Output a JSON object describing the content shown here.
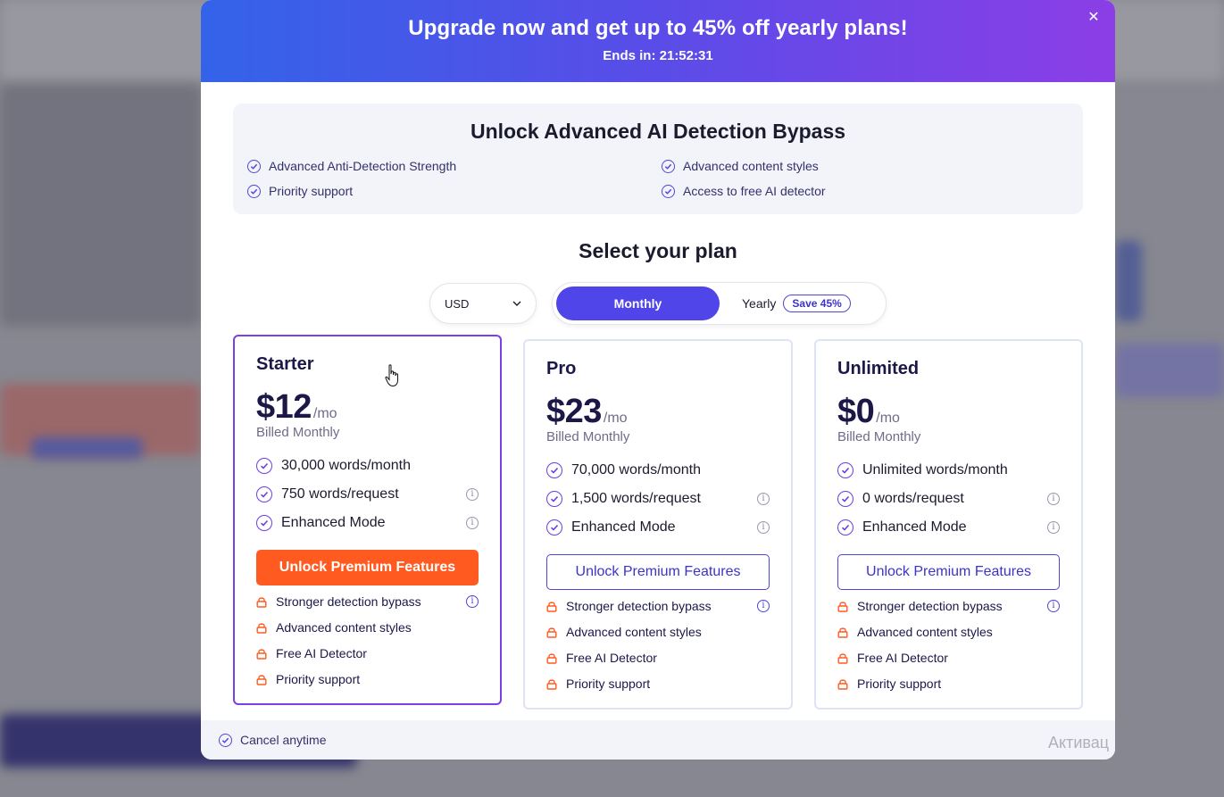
{
  "banner": {
    "title": "Upgrade now and get up to 45% off yearly plans!",
    "timer": "Ends in: 21:52:31",
    "close_symbol": "✕"
  },
  "features": {
    "title": "Unlock Advanced AI Detection Bypass",
    "items": [
      "Advanced Anti-Detection Strength",
      "Advanced content styles",
      "Priority support",
      "Access to free AI detector"
    ]
  },
  "plan_selector": {
    "title": "Select your plan",
    "currency": "USD",
    "monthly_label": "Monthly",
    "yearly_label": "Yearly",
    "save_badge": "Save 45%",
    "selected_period": "Monthly"
  },
  "plans": [
    {
      "name": "Starter",
      "price": "$12",
      "unit": "/mo",
      "billed": "Billed Monthly",
      "quotas": [
        "30,000 words/month",
        "750 words/request",
        "Enhanced Mode"
      ],
      "cta": "Unlock Premium Features",
      "perks": [
        "Stronger detection bypass",
        "Advanced content styles",
        "Free AI Detector",
        "Priority support"
      ],
      "selected": true
    },
    {
      "name": "Pro",
      "price": "$23",
      "unit": "/mo",
      "billed": "Billed Monthly",
      "quotas": [
        "70,000 words/month",
        "1,500 words/request",
        "Enhanced Mode"
      ],
      "cta": "Unlock Premium Features",
      "perks": [
        "Stronger detection bypass",
        "Advanced content styles",
        "Free AI Detector",
        "Priority support"
      ],
      "selected": false
    },
    {
      "name": "Unlimited",
      "price": "$0",
      "unit": "/mo",
      "billed": "Billed Monthly",
      "quotas": [
        "Unlimited words/month",
        "0 words/request",
        "Enhanced Mode"
      ],
      "cta": "Unlock Premium Features",
      "perks": [
        "Stronger detection bypass",
        "Advanced content styles",
        "Free AI Detector",
        "Priority support"
      ],
      "selected": false
    }
  ],
  "footer": {
    "cancel_text": "Cancel anytime"
  },
  "os_watermark": "Активац",
  "icons": {
    "check": "check-circle-icon",
    "lock": "lock-icon",
    "info": "info-icon",
    "close": "close-icon",
    "chevron": "chevron-down-icon",
    "cursor": "hand-cursor-icon"
  },
  "colors": {
    "banner_start": "#3363e9",
    "banner_end": "#8b3ee6",
    "accent": "#4f45e8",
    "cta_primary": "#ff5a1f",
    "selected_border": "#7b3fe4",
    "lock": "#ff5a1f"
  }
}
